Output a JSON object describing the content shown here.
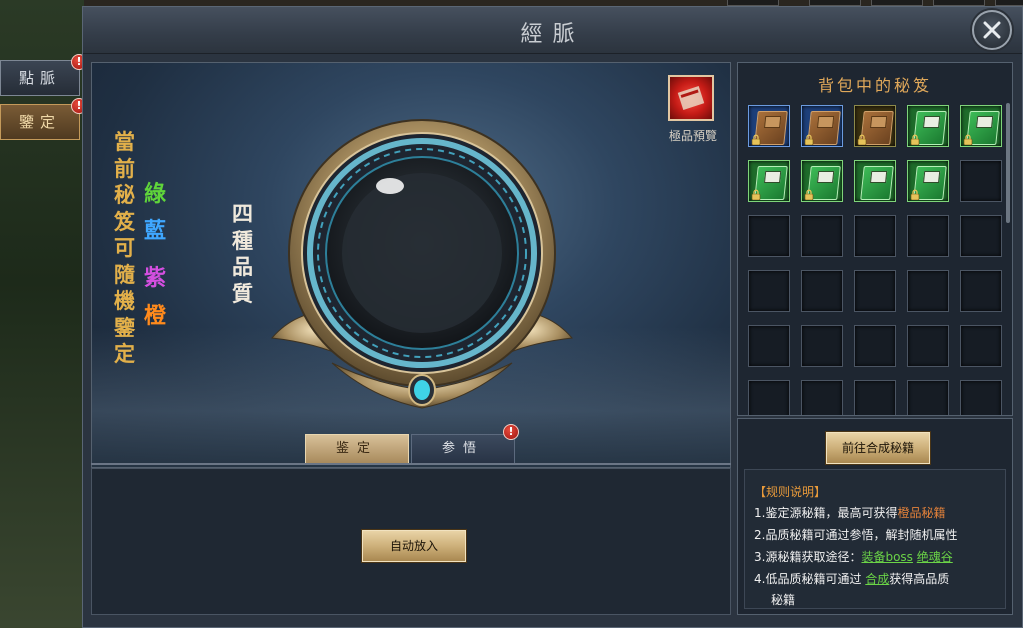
{
  "window": {
    "title": "經脈"
  },
  "side_tabs": [
    {
      "label": "點脈"
    },
    {
      "label": "鑒定"
    }
  ],
  "main": {
    "caption_chars": [
      "當",
      "前",
      "秘",
      "笈",
      "可",
      "隨",
      "機",
      "鑒",
      "定"
    ],
    "quality_chars": [
      "四",
      "種",
      "品",
      "質"
    ],
    "grades": [
      {
        "char": "綠",
        "color": "#5fd43a"
      },
      {
        "char": "藍",
        "color": "#3fa7ff"
      },
      {
        "char": "紫",
        "color": "#d44fe0"
      },
      {
        "char": "橙",
        "color": "#ff8a1c"
      }
    ],
    "preview_label": "極品預覽",
    "tabs": [
      {
        "label": "鉴定",
        "active": true
      },
      {
        "label": "参悟",
        "active": false
      }
    ],
    "auto_place_button": "自动放入"
  },
  "bag": {
    "title": "背包中的秘笈",
    "slots": [
      {
        "quality": "blue",
        "book": "brown",
        "locked": true
      },
      {
        "quality": "blue",
        "book": "brown",
        "locked": true
      },
      {
        "quality": "gold",
        "book": "brown",
        "locked": true
      },
      {
        "quality": "green",
        "book": "green",
        "locked": true
      },
      {
        "quality": "green",
        "book": "green",
        "locked": true
      },
      {
        "quality": "green",
        "book": "green",
        "locked": true
      },
      {
        "quality": "green",
        "book": "green",
        "locked": true
      },
      {
        "quality": "green",
        "book": "green",
        "locked": false
      },
      {
        "quality": "green",
        "book": "green",
        "locked": true
      },
      {
        "quality": "empty"
      },
      {
        "quality": "empty"
      },
      {
        "quality": "empty"
      },
      {
        "quality": "empty"
      },
      {
        "quality": "empty"
      },
      {
        "quality": "empty"
      },
      {
        "quality": "empty"
      },
      {
        "quality": "empty"
      },
      {
        "quality": "empty"
      },
      {
        "quality": "empty"
      },
      {
        "quality": "empty"
      },
      {
        "quality": "empty"
      },
      {
        "quality": "empty"
      },
      {
        "quality": "empty"
      },
      {
        "quality": "empty"
      },
      {
        "quality": "empty"
      },
      {
        "quality": "empty"
      },
      {
        "quality": "empty"
      },
      {
        "quality": "empty"
      },
      {
        "quality": "empty"
      },
      {
        "quality": "empty"
      }
    ]
  },
  "rules": {
    "synth_button": "前往合成秘籍",
    "heading": "【规则说明】",
    "line1_prefix": "1.鉴定源秘籍，最高可获得",
    "line1_highlight": "橙品秘籍",
    "line2": "2.品质秘籍可通过参悟，解封随机属性",
    "line3_prefix": "3.源秘籍获取途径：",
    "line3_link1": "装备boss",
    "line3_link2": "绝魂谷",
    "line4_prefix": "4.低品质秘籍可通过",
    "line4_link": "合成",
    "line4_suffix": "获得高品质",
    "line4_cont": "秘籍"
  },
  "colors": {
    "accent_gold": "#e0a85a",
    "rules_orange": "#e4823a",
    "link_green": "#6bd447"
  }
}
